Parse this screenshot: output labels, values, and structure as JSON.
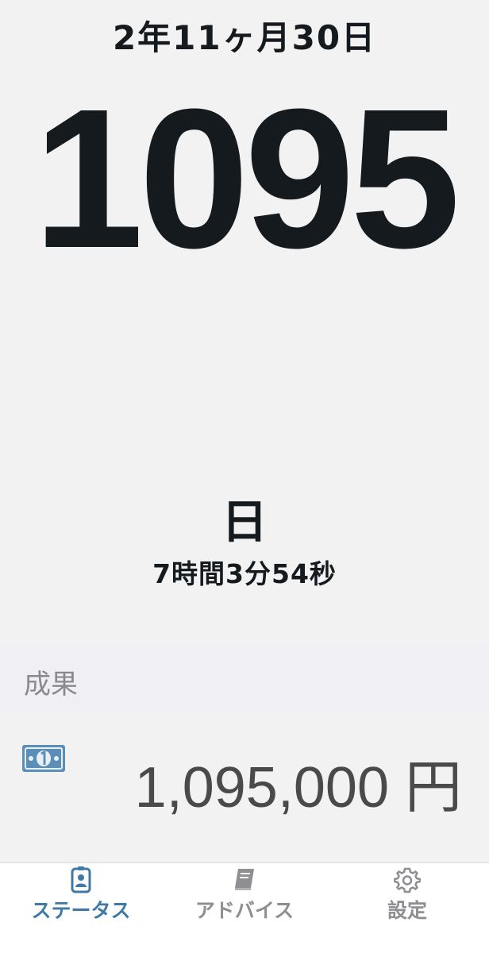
{
  "status": {
    "period_label": "2年11ヶ月30日",
    "days_count": "1095",
    "day_unit": "日",
    "time_remainder": "7時間3分54秒"
  },
  "results": {
    "title": "成果",
    "amount": "1,095,000 円",
    "icon": "money-bill-icon"
  },
  "tabs": [
    {
      "label": "ステータス",
      "icon": "person-card-icon",
      "active": true
    },
    {
      "label": "アドバイス",
      "icon": "book-icon",
      "active": false
    },
    {
      "label": "設定",
      "icon": "gear-icon",
      "active": false
    }
  ],
  "colors": {
    "accent": "#3f7aa6",
    "inactive": "#8e8e93",
    "text": "#151a1f",
    "amount": "#4a4a4a",
    "background": "#f2f2f3"
  }
}
